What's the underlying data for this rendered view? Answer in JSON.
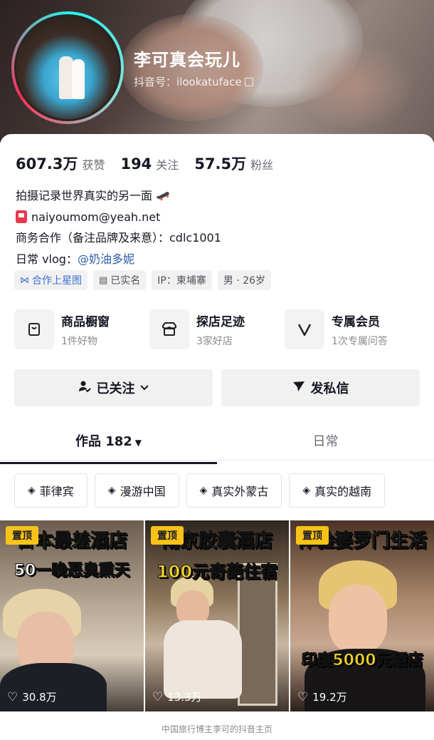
{
  "profile": {
    "nickname": "李可真会玩儿",
    "douyin_id": "抖音号：ilookatuface"
  },
  "stats": [
    {
      "value": "607.3万",
      "label": "获赞"
    },
    {
      "value": "194",
      "label": "关注"
    },
    {
      "value": "57.5万",
      "label": "粉丝"
    }
  ],
  "bio": {
    "line1": "拍摄记录世界真实的另一面",
    "line1_emoji": "🛹",
    "email": "naiyoumom@yeah.net",
    "line3": "商务合作（备注品牌及来意）：cdlc1001",
    "line4_prefix": "日常 vlog：",
    "line4_mention": "@奶油多妮"
  },
  "tags": [
    {
      "label": "合作上星图",
      "icon": "star-chart-icon"
    },
    {
      "label": "已实名",
      "icon": "id-card-icon"
    },
    {
      "label": "IP：柬埔寨",
      "icon": ""
    },
    {
      "label": "男 · 26岁",
      "icon": ""
    }
  ],
  "features": [
    {
      "title": "商品橱窗",
      "sub": "1件好物",
      "icon": "shopping-bag-icon"
    },
    {
      "title": "探店足迹",
      "sub": "3家好店",
      "icon": "store-icon"
    },
    {
      "title": "专属会员",
      "sub": "1次专属问答",
      "icon": "member-v-icon"
    }
  ],
  "actions": {
    "follow_label": "已关注",
    "message_label": "发私信"
  },
  "tabs": {
    "works_label": "作品 182",
    "daily_label": "日常"
  },
  "collections": [
    "菲律宾",
    "漫游中国",
    "真实外蒙古",
    "真实的越南"
  ],
  "videos": [
    {
      "pin": "置顶",
      "title": "日本最差酒店",
      "subtitle": "50一晚恶臭熏天",
      "likes": "30.8万"
    },
    {
      "pin": "置顶",
      "title": "南京胶囊酒店",
      "subtitle": "100元奇葩住宿",
      "likes": "13.3万"
    },
    {
      "pin": "置顶",
      "title": "体验婆罗门生活",
      "subtitle": "印度5000元酒店",
      "likes": "19.2万"
    }
  ],
  "caption": "中国旅行博主李可的抖音主页",
  "colors": {
    "accent_blue": "#2e5aa8",
    "pin_yellow": "#f8c318",
    "ring_cyan": "#25f4ee",
    "ring_pink": "#fe2c55"
  }
}
